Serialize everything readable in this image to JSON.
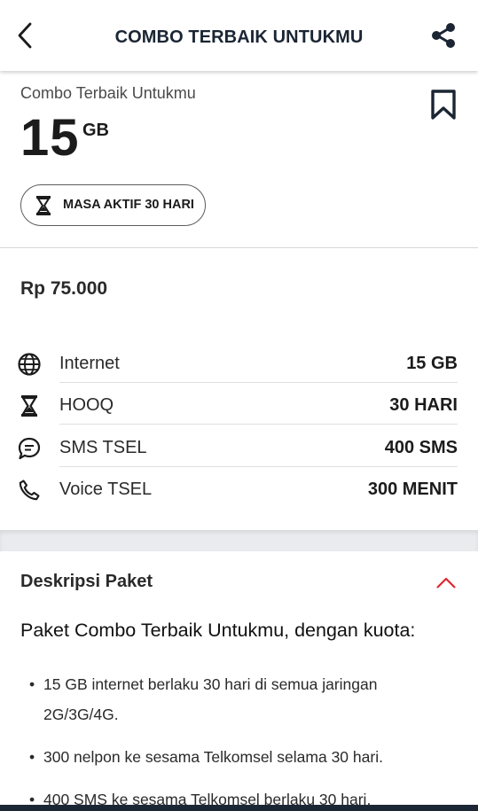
{
  "header": {
    "title": "COMBO TERBAIK UNTUKMU",
    "back_icon": "chevron-left-icon",
    "share_icon": "share-icon"
  },
  "package": {
    "name": "Combo Terbaik Untukmu",
    "quota_value": "15",
    "quota_unit": "GB",
    "bookmark_icon": "bookmark-icon",
    "active_period": "MASA AKTIF 30 HARI",
    "active_period_icon": "hourglass-icon"
  },
  "price": "Rp 75.000",
  "benefits": [
    {
      "icon": "globe-icon",
      "label": "Internet",
      "value": "15 GB"
    },
    {
      "icon": "hourglass-icon",
      "label": "HOOQ",
      "value": "30 HARI"
    },
    {
      "icon": "chat-bubble-icon",
      "label": "SMS TSEL",
      "value": "400 SMS"
    },
    {
      "icon": "phone-icon",
      "label": "Voice TSEL",
      "value": "300 MENIT"
    }
  ],
  "description": {
    "title": "Deskripsi Paket",
    "toggle_icon": "chevron-up-icon",
    "heading": "Paket Combo Terbaik Untukmu, dengan kuota:",
    "items": [
      "15 GB internet berlaku 30 hari di semua jaringan 2G/3G/4G.",
      "300 nelpon ke sesama Telkomsel selama 30 hari.",
      "400 SMS ke sesama Telkomsel berlaku 30 hari."
    ]
  },
  "colors": {
    "accent": "#e0262d",
    "text_dark": "#1b2533",
    "band": "#e9ebee",
    "bottom_bar": "#1c2736"
  }
}
